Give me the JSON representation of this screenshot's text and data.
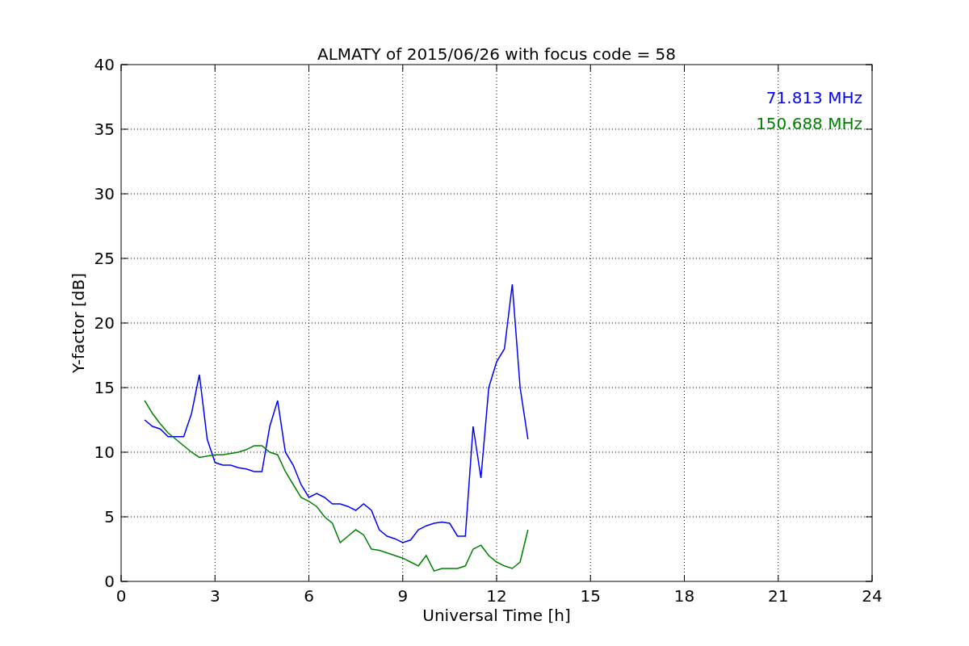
{
  "chart_data": {
    "type": "line",
    "title": "ALMATY of 2015/06/26 with focus code = 58",
    "xlabel": "Universal Time [h]",
    "ylabel": "Y-factor [dB]",
    "x": [
      0.75,
      1.0,
      1.25,
      1.5,
      1.75,
      2.0,
      2.25,
      2.5,
      2.75,
      3.0,
      3.25,
      3.5,
      3.75,
      4.0,
      4.25,
      4.5,
      4.75,
      5.0,
      5.25,
      5.5,
      5.75,
      6.0,
      6.25,
      6.5,
      6.75,
      7.0,
      7.25,
      7.5,
      7.75,
      8.0,
      8.25,
      8.5,
      8.75,
      9.0,
      9.25,
      9.5,
      9.75,
      10.0,
      10.25,
      10.5,
      10.75,
      11.0,
      11.25,
      11.5,
      11.75,
      12.0,
      12.25,
      12.5,
      12.75,
      13.0
    ],
    "series": [
      {
        "name": "71.813 MHz",
        "color": "#0000ff",
        "values": [
          12.5,
          12,
          11.8,
          11.2,
          11.2,
          11.2,
          13,
          16,
          11,
          9.2,
          9,
          9,
          8.8,
          8.7,
          8.5,
          8.5,
          12,
          14,
          10,
          9,
          7.5,
          6.5,
          6.8,
          6.5,
          6,
          6,
          5.8,
          5.5,
          6,
          5.5,
          4,
          3.5,
          3.3,
          3,
          3.2,
          4,
          4.3,
          4.5,
          4.6,
          4.5,
          3.5,
          3.5,
          12,
          8,
          15,
          17,
          18,
          23,
          15,
          11
        ]
      },
      {
        "name": "150.688 MHz",
        "color": "#008000",
        "values": [
          14,
          13,
          12.2,
          11.5,
          11,
          10.5,
          10,
          9.6,
          9.7,
          9.8,
          9.8,
          9.9,
          10,
          10.2,
          10.5,
          10.5,
          10,
          9.8,
          8.5,
          7.5,
          6.5,
          6.2,
          5.8,
          5,
          4.5,
          3,
          3.5,
          4,
          3.6,
          2.5,
          2.4,
          2.2,
          2,
          1.8,
          1.5,
          1.2,
          2,
          0.8,
          1,
          1,
          1,
          1.2,
          2.5,
          2.8,
          2,
          1.5,
          1.2,
          1,
          1.5,
          4
        ]
      }
    ],
    "xlim": [
      0,
      24
    ],
    "ylim": [
      0,
      40
    ],
    "xticks": [
      0,
      3,
      6,
      9,
      12,
      15,
      18,
      21,
      24
    ],
    "yticks": [
      0,
      5,
      10,
      15,
      20,
      25,
      30,
      35,
      40
    ],
    "grid": true
  }
}
